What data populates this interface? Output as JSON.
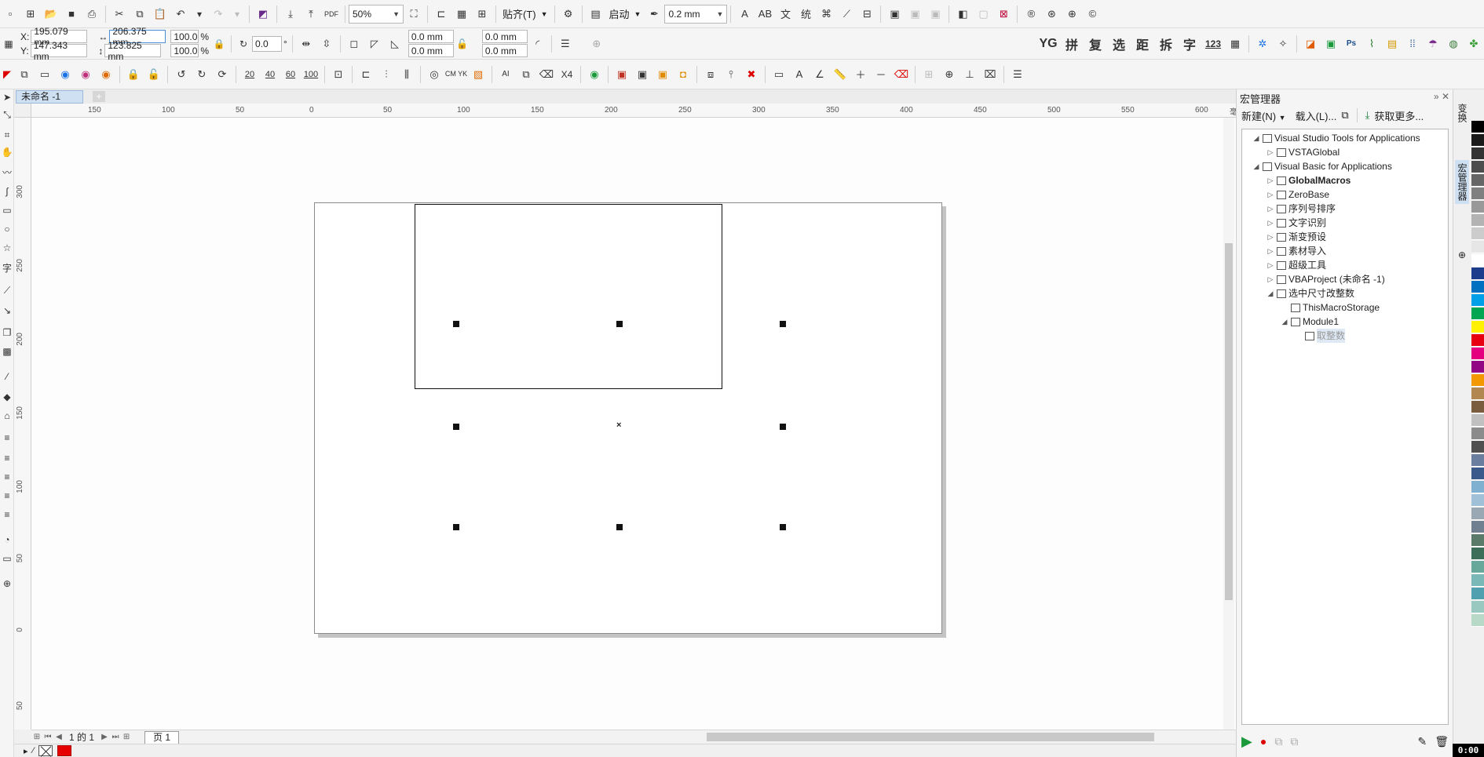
{
  "toolbar_top": {
    "zoom": "50%",
    "snap_label": "贴齐(T)",
    "launch_label": "启动",
    "outline_width": "0.2 mm"
  },
  "property_bar": {
    "x_label": "X:",
    "x_value": "195.079 mm",
    "y_label": "Y:",
    "y_value": "147.343 mm",
    "width_value": "206.375 mm",
    "height_value": "123.825 mm",
    "scale_w": "100.0",
    "scale_h": "100.0",
    "percent": "%",
    "rotation": "0.0",
    "degree_symbol": "°",
    "corner_1": "0.0 mm",
    "corner_2": "0.0 mm",
    "corner_3": "0.0 mm",
    "corner_4": "0.0 mm",
    "plugin_labels": [
      "YG",
      "拼",
      "复",
      "选",
      "距",
      "拆",
      "字",
      "123"
    ]
  },
  "toolbar_third": {
    "num_buttons": [
      "20",
      "40",
      "60",
      "100"
    ],
    "cmyk_label": "CM YK",
    "x4_label": "X4"
  },
  "document": {
    "tab_title": "未命名 -1",
    "page_tab": "页 1",
    "page_nav": "1 的 1",
    "ruler_units": "毫米"
  },
  "ruler_h_ticks": [
    "150",
    "100",
    "50",
    "0",
    "50",
    "100",
    "150",
    "200",
    "250",
    "300",
    "350",
    "400",
    "450",
    "500",
    "550",
    "600"
  ],
  "ruler_v_ticks": [
    "300",
    "250",
    "200",
    "150",
    "100",
    "50",
    "0",
    "50"
  ],
  "macro_panel": {
    "title": "宏管理器",
    "new_label": "新建(N)",
    "load_label": "载入(L)...",
    "get_more_label": "获取更多...",
    "tree": [
      {
        "label": "Visual Studio Tools for Applications",
        "indent": 0,
        "expander": "◢",
        "bold": false
      },
      {
        "label": "VSTAGlobal",
        "indent": 1,
        "expander": "▷",
        "bold": false
      },
      {
        "label": "Visual Basic for Applications",
        "indent": 0,
        "expander": "◢",
        "bold": false
      },
      {
        "label": "GlobalMacros",
        "indent": 1,
        "expander": "▷",
        "bold": true
      },
      {
        "label": "ZeroBase",
        "indent": 1,
        "expander": "▷",
        "bold": false
      },
      {
        "label": "序列号排序",
        "indent": 1,
        "expander": "▷",
        "bold": false
      },
      {
        "label": "文字识别",
        "indent": 1,
        "expander": "▷",
        "bold": false
      },
      {
        "label": "渐变预设",
        "indent": 1,
        "expander": "▷",
        "bold": false
      },
      {
        "label": "素材导入",
        "indent": 1,
        "expander": "▷",
        "bold": false
      },
      {
        "label": "超级工具",
        "indent": 1,
        "expander": "▷",
        "bold": false
      },
      {
        "label": "VBAProject (未命名 -1)",
        "indent": 1,
        "expander": "▷",
        "bold": false
      },
      {
        "label": "选中尺寸改整数",
        "indent": 1,
        "expander": "◢",
        "bold": false
      },
      {
        "label": "ThisMacroStorage",
        "indent": 2,
        "expander": "",
        "bold": false
      },
      {
        "label": "Module1",
        "indent": 2,
        "expander": "◢",
        "bold": false
      },
      {
        "label": "取整数",
        "indent": 3,
        "expander": "",
        "bold": false,
        "selected": true
      }
    ]
  },
  "side_tabs": [
    "变换",
    "宏管理器"
  ],
  "palette_colors": [
    "#000000",
    "#1a1a1a",
    "#333333",
    "#4d4d4d",
    "#666666",
    "#808080",
    "#999999",
    "#b3b3b3",
    "#cccccc",
    "#e6e6e6",
    "#ffffff",
    "#1e3c8c",
    "#0070c0",
    "#00a0e9",
    "#00a651",
    "#fff100",
    "#e60012",
    "#e4007f",
    "#920783",
    "#f39800",
    "#b28850",
    "#7a5c3e",
    "#c0c0c0",
    "#8c8c8c",
    "#505050",
    "#6a7fa0",
    "#3a5a8c",
    "#80b0d0",
    "#a0c0d8",
    "#9aa8b4",
    "#708090",
    "#5a7a6a",
    "#3c6e5a",
    "#68a89a",
    "#7ab8b8",
    "#50a0b0",
    "#98c8c0",
    "#b8d8c8"
  ],
  "clock": "0:00"
}
